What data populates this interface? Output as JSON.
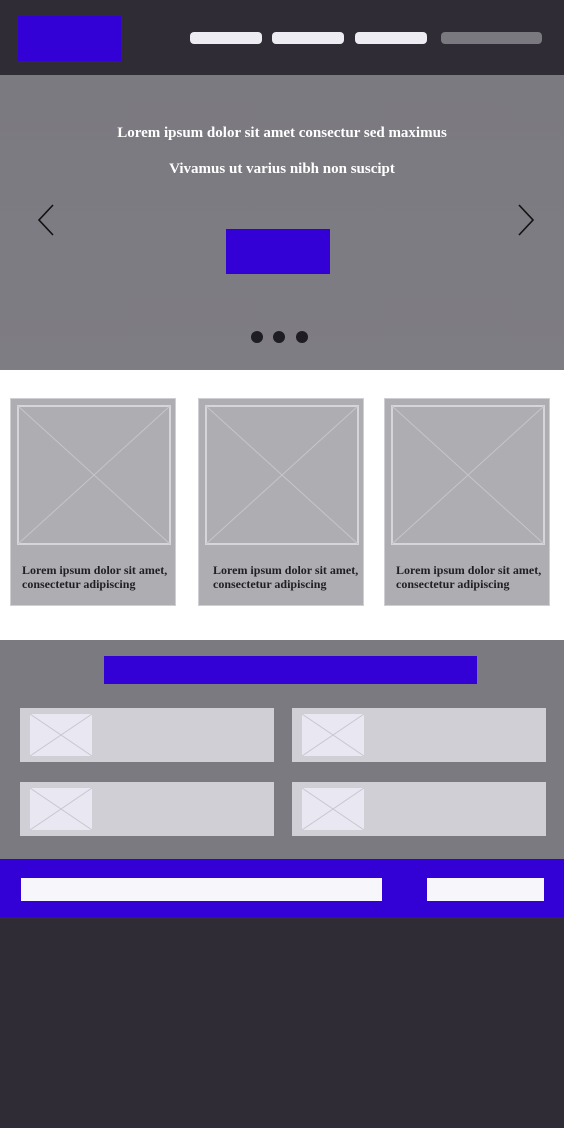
{
  "hero": {
    "title": "Lorem ipsum dolor sit amet consectur sed maximus",
    "subtitle": "Vivamus ut varius nibh non suscipt",
    "slide_count": 3
  },
  "cards": [
    {
      "text": "Lorem ipsum dolor sit amet, consectetur adipiscing",
      "image": "image-placeholder-icon"
    },
    {
      "text": "Lorem ipsum dolor sit amet, consectetur adipiscing",
      "image": "image-placeholder-icon"
    },
    {
      "text": "Lorem ipsum dolor sit amet, consectetur adipiscing",
      "image": "image-placeholder-icon"
    }
  ],
  "icons": {
    "prev": "chevron-left-icon",
    "next": "chevron-right-icon",
    "placeholder": "image-placeholder-icon"
  },
  "colors": {
    "accent": "#3300d6",
    "dark": "#2f2c36",
    "mid_gray": "#7b7a80",
    "card_gray": "#aeadb2",
    "tile_gray": "#d0cfd5"
  }
}
